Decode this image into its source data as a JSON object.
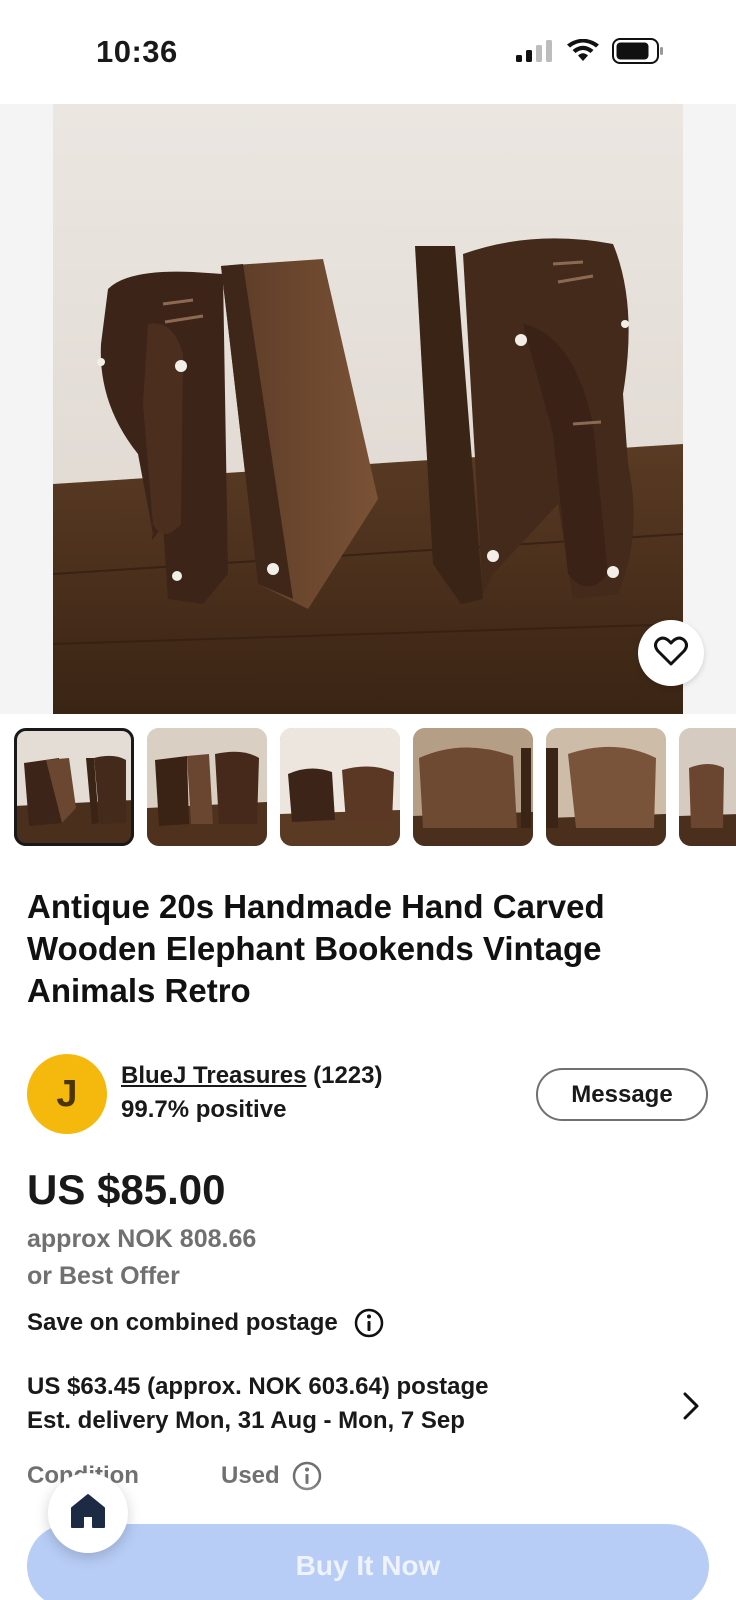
{
  "status_bar": {
    "time": "10:36",
    "icons": [
      "cellular-signal-icon",
      "wifi-icon",
      "battery-icon"
    ]
  },
  "listing": {
    "title": "Antique 20s Handmade Hand Carved Wooden Elephant Bookends Vintage Animals Retro",
    "image_count_visible": 6
  },
  "seller": {
    "avatar_letter": "J",
    "name": "BlueJ Treasures",
    "count": "(1223)",
    "feedback": "99.7% positive",
    "message_label": "Message"
  },
  "price": {
    "main": "US $85.00",
    "approx": "approx NOK 808.66",
    "offer": "or Best Offer"
  },
  "shipping": {
    "combined_label": "Save on combined postage",
    "postage": "US $63.45 (approx. NOK 603.64) postage",
    "delivery": "Est. delivery Mon, 31 Aug - Mon, 7 Sep"
  },
  "condition": {
    "label": "Condition",
    "value": "Used"
  },
  "cta": {
    "buy_label": "Buy It Now"
  },
  "colors": {
    "avatar": "#f5b80c",
    "buy_button": "#b7cdf6",
    "text": "#191919",
    "muted": "#707070"
  }
}
